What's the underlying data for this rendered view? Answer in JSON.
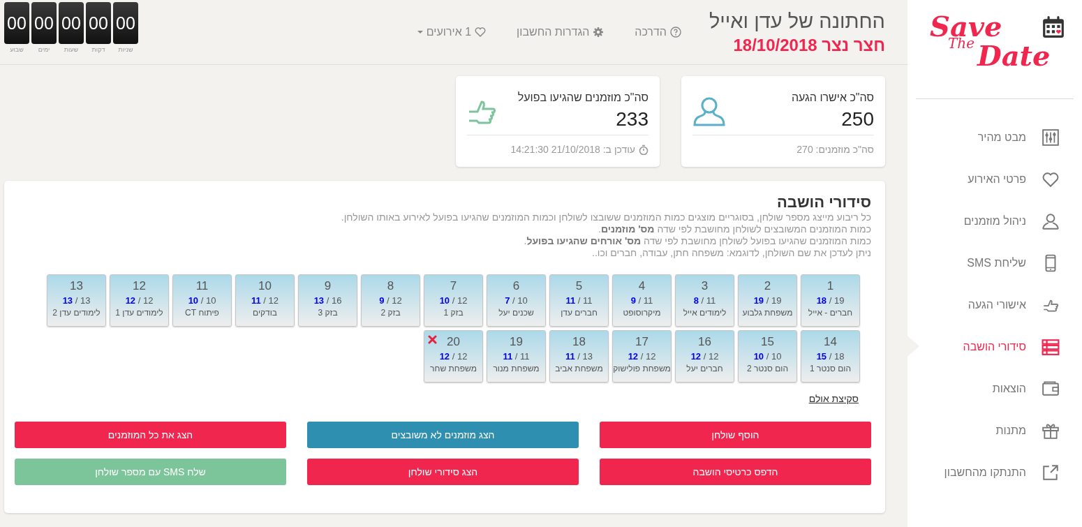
{
  "sidebar": {
    "logo": {
      "line1": "Save",
      "line2": "The",
      "line3": "Date"
    },
    "items": [
      {
        "label": "מבט מהיר",
        "selected": false
      },
      {
        "label": "פרטי האירוע",
        "selected": false
      },
      {
        "label": "ניהול מוזמנים",
        "selected": false
      },
      {
        "label": "שליחת SMS",
        "selected": false
      },
      {
        "label": "אישורי הגעה",
        "selected": false
      },
      {
        "label": "סידורי הושבה",
        "selected": true
      },
      {
        "label": "הוצאות",
        "selected": false
      },
      {
        "label": "מתנות",
        "selected": false
      },
      {
        "label": "התנתקו מהחשבון",
        "selected": false
      }
    ]
  },
  "header": {
    "title": "החתונה של עדן ואייל",
    "subtitle": "חצר נצר 18/10/2018",
    "links": [
      {
        "label": "הדרכה"
      },
      {
        "label": "הגדרות החשבון"
      },
      {
        "label": "1 אירועים"
      }
    ],
    "countdown": [
      {
        "value": "00",
        "unit": "שניות"
      },
      {
        "value": "00",
        "unit": "דקות"
      },
      {
        "value": "00",
        "unit": "שעות"
      },
      {
        "value": "00",
        "unit": "ימים"
      },
      {
        "value": "00",
        "unit": "שבוע"
      }
    ]
  },
  "stats": [
    {
      "title": "סה\"כ אישרו הגעה",
      "value": "250",
      "footer": "סה\"כ מוזמנים: 270"
    },
    {
      "title": "סה\"כ מוזמנים שהגיעו בפועל",
      "value": "233",
      "footer": "עודכן ב: 21/10/2018 14:21:30"
    }
  ],
  "seating": {
    "title": "סידורי הושבה",
    "description": [
      "כל ריבוע מייצג מספר שולחן, בסוגריים מוצגים כמות המוזמנים ששובצו לשולחן וכמות המוזמנים שהגיעו בפועל לאירוע באותו השולחן.",
      "כמות המוזמנים המשובצים לשולחן מחושבת לפי שדה **מס' מוזמנים**.",
      "כמות המוזמנים שהגיעו בפועל לשולחן מחושבת לפי שדה **מס' אורחים שהגיעו בפועל**.",
      "ניתן לעדכן את שם השולחן, לדוגמא: משפחה חתן, עבודה, חברים וכו.."
    ],
    "tables": [
      {
        "number": "1",
        "counts": "**18** / 19",
        "name": "חברים - אייל",
        "deletable": false
      },
      {
        "number": "2",
        "counts": "**19** / 19",
        "name": "משפחת גלבוע",
        "deletable": false
      },
      {
        "number": "3",
        "counts": "**8** / 11",
        "name": "לימודים אייל",
        "deletable": false
      },
      {
        "number": "4",
        "counts": "**9** / 11",
        "name": "מיקרוסופט",
        "deletable": false
      },
      {
        "number": "5",
        "counts": "**11** / 11",
        "name": "חברים עדן",
        "deletable": false
      },
      {
        "number": "6",
        "counts": "**7** / 10",
        "name": "שכנים יעל",
        "deletable": false
      },
      {
        "number": "7",
        "counts": "**10** / 12",
        "name": "בזק 1",
        "deletable": false
      },
      {
        "number": "8",
        "counts": "**9** / 12",
        "name": "בזק 2",
        "deletable": false
      },
      {
        "number": "9",
        "counts": "**13** / 16",
        "name": "בזק 3",
        "deletable": false
      },
      {
        "number": "10",
        "counts": "**11** / 12",
        "name": "בודקים",
        "deletable": false
      },
      {
        "number": "11",
        "counts": "**10** / 10",
        "name": "פיתוח CT",
        "deletable": false
      },
      {
        "number": "12",
        "counts": "**12** / 12",
        "name": "לימודים עדן 1",
        "deletable": false
      },
      {
        "number": "13",
        "counts": "**13** / 13",
        "name": "לימודים עדן 2",
        "deletable": false
      },
      {
        "number": "14",
        "counts": "**15** / 18",
        "name": "הום סנטר 1",
        "deletable": false
      },
      {
        "number": "15",
        "counts": "**10** / 10",
        "name": "הום סנטר 2",
        "deletable": false
      },
      {
        "number": "16",
        "counts": "**12** / 12",
        "name": "חברים יעל",
        "deletable": false
      },
      {
        "number": "17",
        "counts": "**12** / 12",
        "name": "משפחת פולישוק",
        "deletable": false
      },
      {
        "number": "18",
        "counts": "**11** / 13",
        "name": "משפחת אביב",
        "deletable": false
      },
      {
        "number": "19",
        "counts": "**11** / 11",
        "name": "משפחת מנור",
        "deletable": false
      },
      {
        "number": "20",
        "counts": "**12** / 12",
        "name": "משפחת שחר",
        "deletable": true
      }
    ],
    "hall_link": "סקיצת אולם",
    "buttons": [
      {
        "label": "הוסף שולחן",
        "kind": "danger"
      },
      {
        "label": "הצג מוזמנים לא משובצים",
        "kind": "info"
      },
      {
        "label": "הצג את כל המוזמנים",
        "kind": "danger"
      },
      {
        "label": "הדפס כרטיסי הושבה",
        "kind": "danger"
      },
      {
        "label": "הצג סידורי שולחן",
        "kind": "danger"
      },
      {
        "label": "שלח SMS עם מספר שולחן",
        "kind": "success"
      }
    ]
  }
}
